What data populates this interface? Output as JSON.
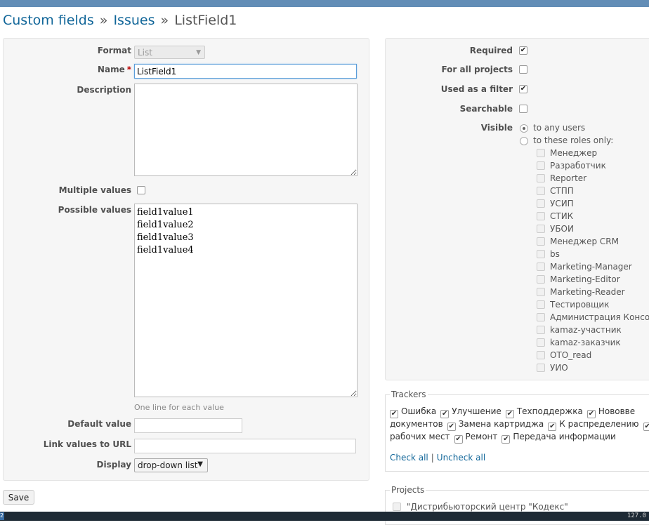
{
  "breadcrumb": {
    "custom_fields": "Custom fields",
    "separator": "»",
    "issues": "Issues",
    "current": "ListField1"
  },
  "form": {
    "format_label": "Format",
    "format_value": "List",
    "name_label": "Name",
    "required_marker": "*",
    "name_value": "ListField1",
    "description_label": "Description",
    "description_value": "",
    "multiple_values_label": "Multiple values",
    "possible_values_label": "Possible values",
    "possible_values_value": "field1value1\nfield1value2\nfield1value3\nfield1value4",
    "possible_values_hint": "One line for each value",
    "default_value_label": "Default value",
    "default_value": "",
    "link_values_label": "Link values to URL",
    "link_values_value": "",
    "display_label": "Display",
    "display_value": "drop-down list"
  },
  "options": {
    "required_label": "Required",
    "required_checked": true,
    "for_all_projects_label": "For all projects",
    "for_all_projects_checked": false,
    "used_as_filter_label": "Used as a filter",
    "used_as_filter_checked": true,
    "searchable_label": "Searchable",
    "searchable_checked": false,
    "visible_label": "Visible",
    "visible_any_users": "to any users",
    "visible_roles_only": "to these roles only:",
    "roles": [
      "Менеджер",
      "Разработчик",
      "Reporter",
      "СТПП",
      "УСИП",
      "СТИК",
      "УБОИ",
      "Менеджер CRM",
      "bs",
      "Marketing-Manager",
      "Marketing-Editor",
      "Marketing-Reader",
      "Тестировщик",
      "Администрация Консор",
      "kamaz-участник",
      "kamaz-заказчик",
      "ОТО_read",
      "УИО"
    ]
  },
  "trackers": {
    "legend": "Trackers",
    "row1": [
      "Ошибка",
      "Улучшение",
      "Техподдержка",
      "Нововве"
    ],
    "row2": [
      "документов",
      "Замена картриджа",
      "К распределению"
    ],
    "row3": [
      "рабочих мест",
      "Ремонт",
      "Передача информации"
    ],
    "check_all": "Check all",
    "link_separator": "|",
    "uncheck_all": "Uncheck all"
  },
  "projects": {
    "legend": "Projects",
    "first_project": "\"Дистрибьюторский центр \"Кодекс\""
  },
  "save_button": "Save",
  "status_bar": {
    "left_tag": "2",
    "right_text": "127.0"
  }
}
